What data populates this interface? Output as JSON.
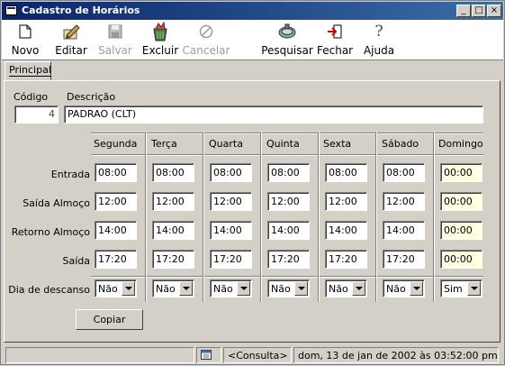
{
  "window": {
    "title": "Cadastro de Horários"
  },
  "toolbar": {
    "novo": "Novo",
    "editar": "Editar",
    "salvar": "Salvar",
    "excluir": "Excluir",
    "cancelar": "Cancelar",
    "pesquisar": "Pesquisar",
    "fechar": "Fechar",
    "ajuda": "Ajuda"
  },
  "tabs": {
    "principal": "Principal"
  },
  "form": {
    "codigo_label": "Código",
    "codigo_value": "4",
    "descricao_label": "Descrição",
    "descricao_value": "PADRAO (CLT)"
  },
  "days": [
    "Segunda",
    "Terça",
    "Quarta",
    "Quinta",
    "Sexta",
    "Sábado",
    "Domingo"
  ],
  "rows": {
    "entrada": {
      "label": "Entrada",
      "values": [
        "08:00",
        "08:00",
        "08:00",
        "08:00",
        "08:00",
        "08:00",
        "00:00"
      ]
    },
    "saida_almoco": {
      "label": "Saída Almoço",
      "values": [
        "12:00",
        "12:00",
        "12:00",
        "12:00",
        "12:00",
        "12:00",
        "00:00"
      ]
    },
    "retorno_almoco": {
      "label": "Retorno Almoço",
      "values": [
        "14:00",
        "14:00",
        "14:00",
        "14:00",
        "14:00",
        "14:00",
        "00:00"
      ]
    },
    "saida": {
      "label": "Saída",
      "values": [
        "17:20",
        "17:20",
        "17:20",
        "17:20",
        "17:20",
        "17:20",
        "00:00"
      ]
    },
    "descanso": {
      "label": "Dia de descanso",
      "values": [
        "Não",
        "Não",
        "Não",
        "Não",
        "Não",
        "Não",
        "Sim"
      ]
    }
  },
  "buttons": {
    "copiar": "Copiar"
  },
  "status": {
    "mode": "<Consulta>",
    "datetime": "dom, 13 de jan de 2002 às 03:52:00 pm"
  },
  "icons": {
    "novo": "new-document-icon",
    "editar": "edit-pen-icon",
    "salvar": "save-disk-icon",
    "excluir": "delete-trash-icon",
    "cancelar": "cancel-icon",
    "pesquisar": "search-binoculars-icon",
    "fechar": "exit-door-icon",
    "ajuda": "help-question-icon",
    "calendar": "calendar-icon"
  }
}
